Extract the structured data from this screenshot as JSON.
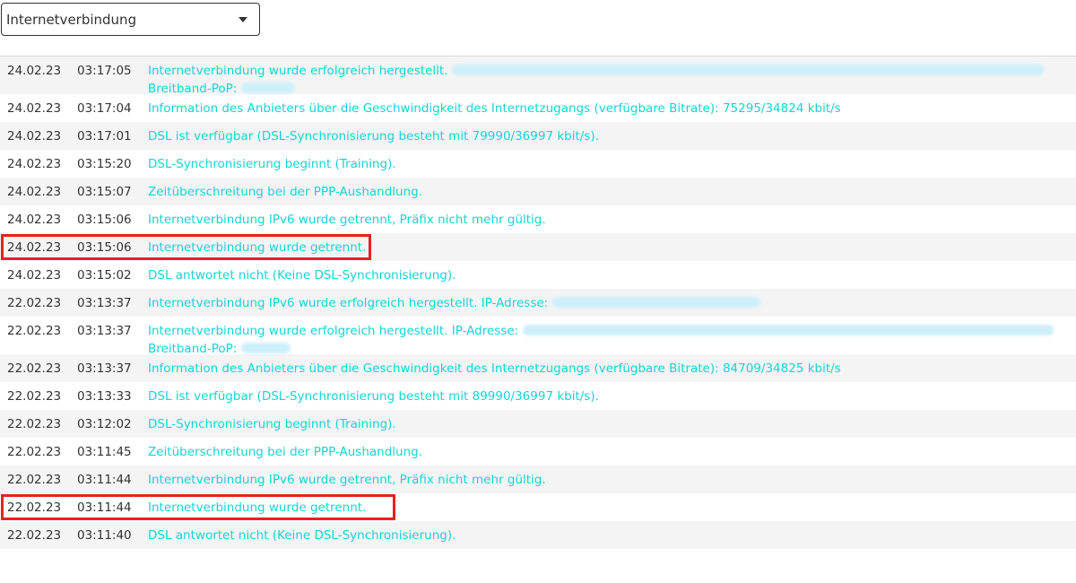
{
  "filter": {
    "selected": "Internetverbindung"
  },
  "colors": {
    "message": "#16d4d4",
    "highlight": "#e8211d"
  },
  "rows": [
    {
      "date": "24.02.23",
      "time": "03:17:05",
      "message": "Internetverbindung wurde erfolgreich hergestellt.",
      "message2": "Breitband-PoP:",
      "redacted": true
    },
    {
      "date": "24.02.23",
      "time": "03:17:04",
      "message": "Information des Anbieters über die Geschwindigkeit des Internetzugangs (verfügbare Bitrate): 75295/34824 kbit/s"
    },
    {
      "date": "24.02.23",
      "time": "03:17:01",
      "message": "DSL ist verfügbar (DSL-Synchronisierung besteht mit 79990/36997 kbit/s)."
    },
    {
      "date": "24.02.23",
      "time": "03:15:20",
      "message": "DSL-Synchronisierung beginnt (Training)."
    },
    {
      "date": "24.02.23",
      "time": "03:15:07",
      "message": "Zeitüberschreitung bei der PPP-Aushandlung."
    },
    {
      "date": "24.02.23",
      "time": "03:15:06",
      "message": "Internetverbindung IPv6 wurde getrennt, Präfix nicht mehr gültig."
    },
    {
      "date": "24.02.23",
      "time": "03:15:06",
      "message": "Internetverbindung wurde getrennt.",
      "highlighted": true
    },
    {
      "date": "24.02.23",
      "time": "03:15:02",
      "message": "DSL antwortet nicht (Keine DSL-Synchronisierung)."
    },
    {
      "date": "22.02.23",
      "time": "03:13:37",
      "message": "Internetverbindung IPv6 wurde erfolgreich hergestellt. IP-Adresse:",
      "redacted": true
    },
    {
      "date": "22.02.23",
      "time": "03:13:37",
      "message": "Internetverbindung wurde erfolgreich hergestellt. IP-Adresse:",
      "message2": "Breitband-PoP:",
      "redacted": true
    },
    {
      "date": "22.02.23",
      "time": "03:13:37",
      "message": "Information des Anbieters über die Geschwindigkeit des Internetzugangs (verfügbare Bitrate): 84709/34825 kbit/s"
    },
    {
      "date": "22.02.23",
      "time": "03:13:33",
      "message": "DSL ist verfügbar (DSL-Synchronisierung besteht mit 89990/36997 kbit/s)."
    },
    {
      "date": "22.02.23",
      "time": "03:12:02",
      "message": "DSL-Synchronisierung beginnt (Training)."
    },
    {
      "date": "22.02.23",
      "time": "03:11:45",
      "message": "Zeitüberschreitung bei der PPP-Aushandlung."
    },
    {
      "date": "22.02.23",
      "time": "03:11:44",
      "message": "Internetverbindung IPv6 wurde getrennt, Präfix nicht mehr gültig."
    },
    {
      "date": "22.02.23",
      "time": "03:11:44",
      "message": "Internetverbindung wurde getrennt.",
      "highlighted": true
    },
    {
      "date": "22.02.23",
      "time": "03:11:40",
      "message": "DSL antwortet nicht (Keine DSL-Synchronisierung)."
    }
  ]
}
